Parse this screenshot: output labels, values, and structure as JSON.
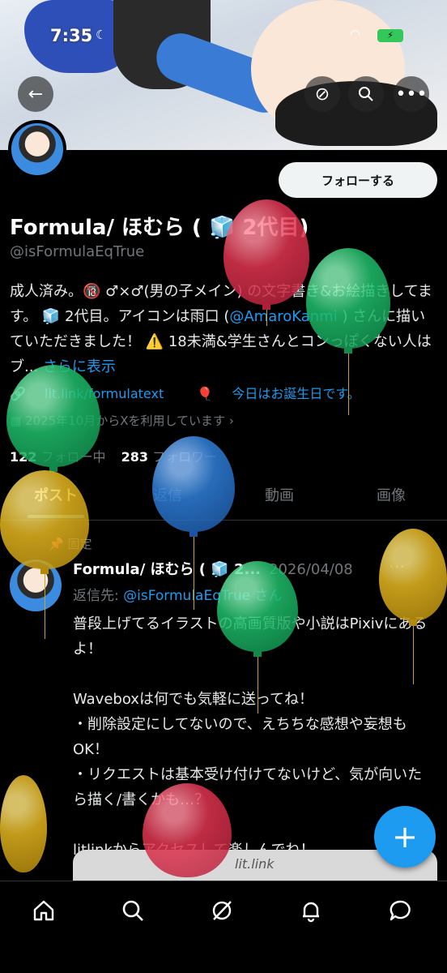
{
  "status_bar": {
    "time": "7:35"
  },
  "profile": {
    "name": "Formula/ ほむら ( 🧊 2代目)",
    "handle": "@isFormulaEqTrue",
    "follow_label": "フォローする",
    "bio_part1": "成人済み。🔞 ♂×♂(男の子メイン) の文字書き&お絵描きしてます。 🧊 2代目。アイコンは雨口 (",
    "bio_mention": "@AmaroKanmi",
    "bio_part2": " ) さんに描いていただきました！ ⚠️ 18未満&学生さんとコンっぽくない人はブ...",
    "bio_more": "さらに表示",
    "link": "lit.link/formulatext",
    "birthday": "今日はお誕生日です。",
    "joined": "2025年10月からXを利用しています",
    "following_count": "122",
    "following_label": "フォロー中",
    "followers_count": "283",
    "followers_label": "フォロワー"
  },
  "tabs": [
    {
      "label": "ポスト"
    },
    {
      "label": "返信"
    },
    {
      "label": "動画"
    },
    {
      "label": "画像"
    }
  ],
  "pinned_post": {
    "pinned_label": "固定",
    "author": "Formula/ ほむら ( 🧊 2...",
    "date": "2026/04/08",
    "reply_prefix": "返信先: ",
    "reply_to": "@isFormulaEqTrue さん",
    "body": "普段上げてるイラストの高画質版や小説はPixivにあるよ！\n\nWaveboxは何でも気軽に送ってね！\n・削除設定にしてないので、えちちな感想や妄想もOK！\n・リクエストは基本受け付けてないけど、気が向いたら描く/書くかも…？\n\nlitlinkからアクセスして楽しんでね！",
    "card_text": "lit.link"
  },
  "colors": {
    "accent": "#1d9bf0",
    "balloon_red": "#e0344f",
    "balloon_green": "#1fbf6b",
    "balloon_blue": "#2f7fd9",
    "balloon_yellow": "#e4b61f"
  },
  "icons": {
    "back": "arrow-left-icon",
    "grok": "grok-icon",
    "search": "search-icon",
    "more": "more-icon",
    "compose": "plus-icon",
    "nav": [
      "home-icon",
      "search-icon",
      "grok-icon",
      "bell-icon",
      "message-icon"
    ]
  }
}
